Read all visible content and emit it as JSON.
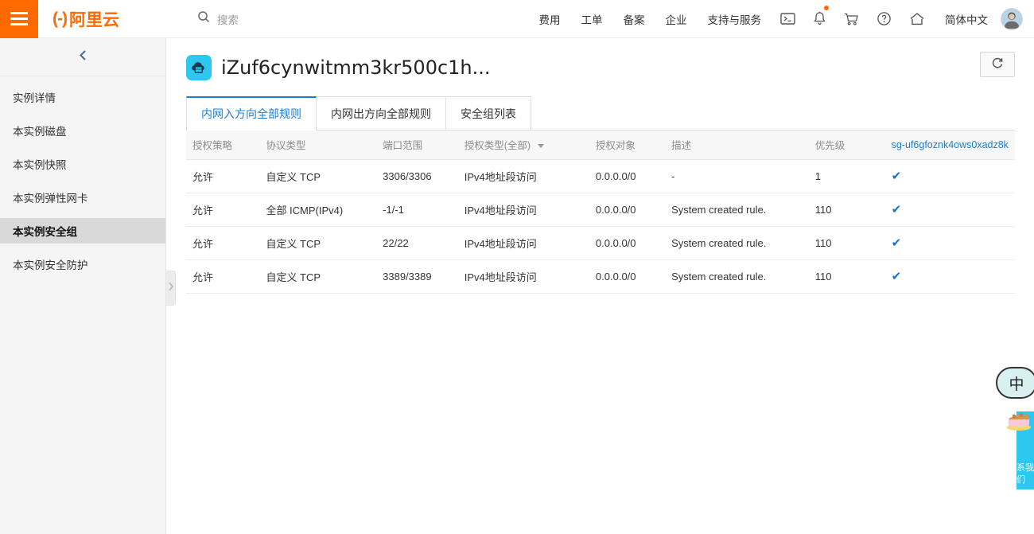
{
  "topbar": {
    "menu_icon": "hamburger-icon",
    "brand_mark": "(-)",
    "brand_text": "阿里云",
    "search": {
      "icon": "search-icon",
      "placeholder": "搜索",
      "value": ""
    },
    "links": [
      "费用",
      "工单",
      "备案",
      "企业",
      "支持与服务"
    ],
    "icons": [
      "terminal-icon",
      "bell-icon",
      "cart-icon",
      "help-icon",
      "home-icon"
    ],
    "notification_dot": true,
    "language": "简体中文",
    "avatar": "user-avatar"
  },
  "sidebar": {
    "collapse_icon": "chevron-left-icon",
    "expand_handle_icon": "chevron-right-icon",
    "items": [
      {
        "label": "实例详情",
        "active": false
      },
      {
        "label": "本实例磁盘",
        "active": false
      },
      {
        "label": "本实例快照",
        "active": false
      },
      {
        "label": "本实例弹性网卡",
        "active": false
      },
      {
        "label": "本实例安全组",
        "active": true
      },
      {
        "label": "本实例安全防护",
        "active": false
      }
    ]
  },
  "page": {
    "instance_icon": "cloud-server-icon",
    "title": "iZuf6cynwitmm3kr500c1h...",
    "refresh_icon": "refresh-icon"
  },
  "tabs": [
    {
      "label": "内网入方向全部规则",
      "active": true
    },
    {
      "label": "内网出方向全部规则",
      "active": false
    },
    {
      "label": "安全组列表",
      "active": false
    }
  ],
  "table": {
    "headers": [
      "授权策略",
      "协议类型",
      "端口范围",
      "授权类型(全部)",
      "授权对象",
      "描述",
      "优先级"
    ],
    "filter_header_index": 3,
    "filter_caret_icon": "chevron-down-icon",
    "security_group_link": "sg-uf6gfoznk4ows0xadz8k",
    "check_icon": "check-icon",
    "rows": [
      {
        "policy": "允许",
        "protocol": "自定义 TCP",
        "port": "3306/3306",
        "auth_type": "IPv4地址段访问",
        "auth_object": "0.0.0.0/0",
        "description": "-",
        "priority": "1",
        "enabled": true
      },
      {
        "policy": "允许",
        "protocol": "全部 ICMP(IPv4)",
        "port": "-1/-1",
        "auth_type": "IPv4地址段访问",
        "auth_object": "0.0.0.0/0",
        "description": "System created rule.",
        "priority": "110",
        "enabled": true
      },
      {
        "policy": "允许",
        "protocol": "自定义 TCP",
        "port": "22/22",
        "auth_type": "IPv4地址段访问",
        "auth_object": "0.0.0.0/0",
        "description": "System created rule.",
        "priority": "110",
        "enabled": true
      },
      {
        "policy": "允许",
        "protocol": "自定义 TCP",
        "port": "3389/3389",
        "auth_type": "IPv4地址段访问",
        "auth_object": "0.0.0.0/0",
        "description": "System created rule.",
        "priority": "110",
        "enabled": true
      }
    ]
  },
  "widgets": {
    "bubble_label": "中",
    "contact_label": "联系我们",
    "contact_visible_label": "系我们",
    "cake_icon": "cake-icon"
  },
  "colors": {
    "brand_orange": "#ff6a00",
    "link_blue": "#1a7fd4",
    "accent_cyan": "#2ec7ef",
    "check_blue": "#1573c8"
  }
}
